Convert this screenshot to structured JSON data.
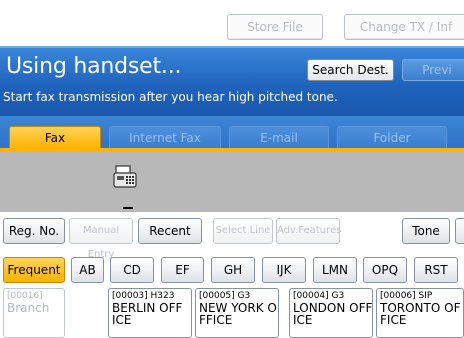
{
  "top_bar": {
    "store_file": "Store File",
    "change_tx": "Change TX / Inf"
  },
  "header": {
    "title": "Using handset...",
    "subtitle": "Start fax transmission after you hear high pitched tone.",
    "search_dest": "Search Dest.",
    "preview": "Previ"
  },
  "tabs": [
    {
      "label": "Fax",
      "active": true
    },
    {
      "label": "Internet Fax",
      "active": false
    },
    {
      "label": "E-mail",
      "active": false
    },
    {
      "label": "Folder",
      "active": false
    }
  ],
  "preview_area": {
    "icon": "fax-machine-icon"
  },
  "toolbar": {
    "reg_no": "Reg. No.",
    "manual_entry": "Manual Entry",
    "recent": "Recent",
    "select_line": "Select Line",
    "adv_features": "Adv.Features",
    "tone": "Tone"
  },
  "index_tabs": [
    "Frequent",
    "AB",
    "CD",
    "EF",
    "GH",
    "IJK",
    "LMN",
    "OPQ",
    "RST"
  ],
  "destinations": [
    {
      "header": "[00016]",
      "name": "Branch",
      "enabled": false
    },
    {
      "header": "[00003] H323",
      "name": "BERLIN OFF\nICE",
      "enabled": true
    },
    {
      "header": "[00005] G3",
      "name": "NEW YORK O\nFFICE",
      "enabled": true
    },
    {
      "header": "[00004] G3",
      "name": "LONDON OFF\nICE",
      "enabled": true
    },
    {
      "header": "[00006] SIP",
      "name": "TORONTO OF\nFICE",
      "enabled": true
    }
  ],
  "colors": {
    "accent": "#ffb300",
    "header_blue": "#1f63bd",
    "preview_grey": "#b8b8b8"
  }
}
